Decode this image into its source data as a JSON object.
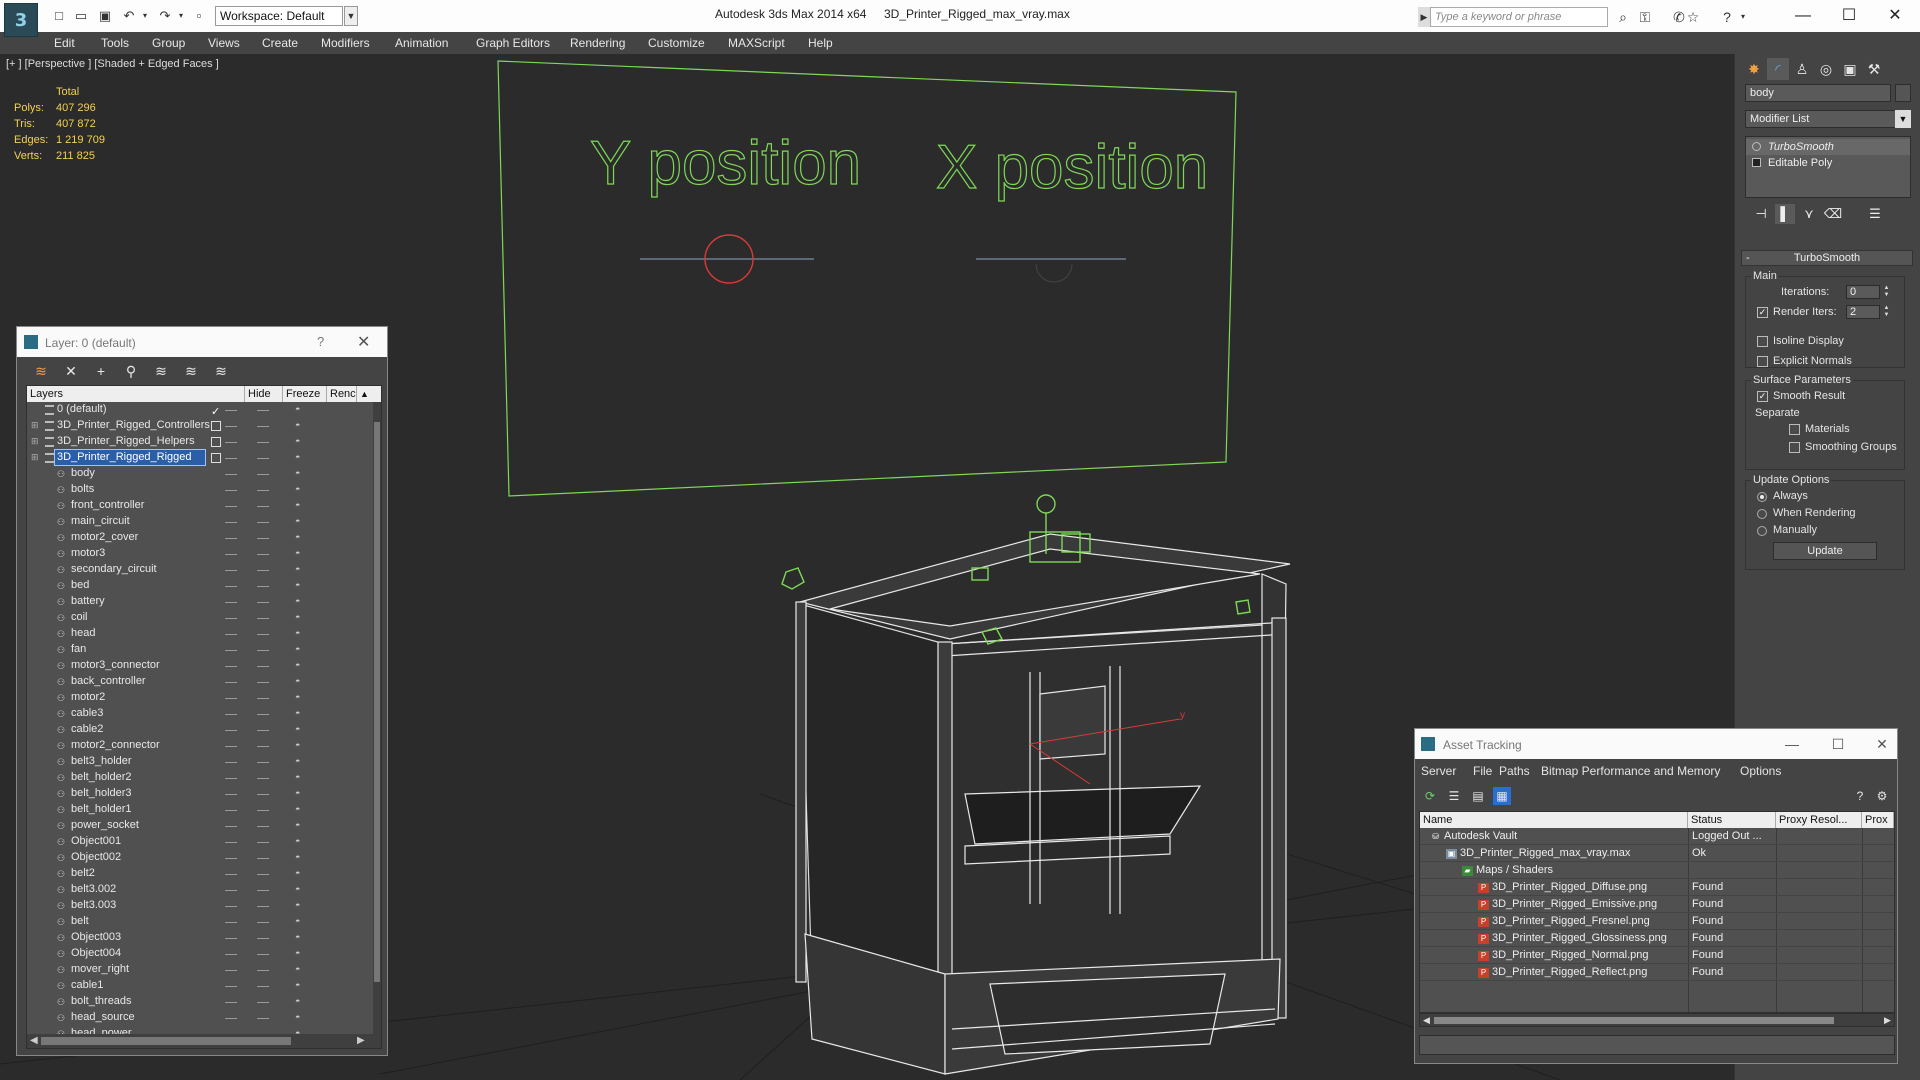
{
  "titlebar": {
    "workspace": "Workspace: Default",
    "app_title": "Autodesk 3ds Max  2014 x64",
    "file_title": "3D_Printer_Rigged_max_vray.max",
    "search_placeholder": "Type a keyword or phrase"
  },
  "menu": [
    "Edit",
    "Tools",
    "Group",
    "Views",
    "Create",
    "Modifiers",
    "Animation",
    "Graph Editors",
    "Rendering",
    "Customize",
    "MAXScript",
    "Help"
  ],
  "viewport": {
    "label": "[+ ] [Perspective ] [Shaded + Edged Faces ]",
    "stats_header": "Total",
    "stats": [
      {
        "label": "Polys:",
        "value": "407 296"
      },
      {
        "label": "Tris:",
        "value": "407 872"
      },
      {
        "label": "Edges:",
        "value": "1 219 709"
      },
      {
        "label": "Verts:",
        "value": "211 825"
      }
    ],
    "ui_text_y": "Y position",
    "ui_text_x": "X position",
    "axis_y": "y"
  },
  "command_panel": {
    "object_name": "body",
    "modifier_list": "Modifier List",
    "stack": [
      "TurboSmooth",
      "Editable Poly"
    ],
    "rollout_title": "TurboSmooth",
    "main_group": "Main",
    "iterations_label": "Iterations:",
    "iterations_value": "0",
    "render_iters_label": "Render Iters:",
    "render_iters_value": "2",
    "render_iters_checked": "✓",
    "isoline_label": "Isoline Display",
    "explicit_label": "Explicit Normals",
    "surface_group": "Surface Parameters",
    "smooth_result_label": "Smooth Result",
    "smooth_result_checked": "✓",
    "separate_label": "Separate",
    "materials_label": "Materials",
    "smoothing_groups_label": "Smoothing Groups",
    "update_options_group": "Update Options",
    "update_always": "Always",
    "update_rendering": "When Rendering",
    "update_manually": "Manually",
    "update_button": "Update"
  },
  "layer_dialog": {
    "title": "Layer: 0 (default)",
    "help": "?",
    "columns": [
      "Layers",
      "Hide",
      "Freeze",
      "Renc"
    ],
    "current_mark": "✓",
    "layers": [
      {
        "name": "0 (default)",
        "level": 0,
        "current": true
      },
      {
        "name": "3D_Printer_Rigged_Controllers",
        "level": 0,
        "expand": true
      },
      {
        "name": "3D_Printer_Rigged_Helpers",
        "level": 0,
        "expand": true
      },
      {
        "name": "3D_Printer_Rigged_Rigged",
        "level": 0,
        "expand": true,
        "selected": true
      }
    ],
    "objects": [
      "body",
      "bolts",
      "front_controller",
      "main_circuit",
      "motor2_cover",
      "motor3",
      "secondary_circuit",
      "bed",
      "battery",
      "coil",
      "head",
      "fan",
      "motor3_connector",
      "back_controller",
      "motor2",
      "cable3",
      "cable2",
      "motor2_connector",
      "belt3_holder",
      "belt_holder2",
      "belt_holder3",
      "belt_holder1",
      "power_socket",
      "Object001",
      "Object002",
      "belt2",
      "belt3.002",
      "belt3.003",
      "belt",
      "Object003",
      "Object004",
      "mover_right",
      "cable1",
      "bolt_threads",
      "head_source",
      "head_power"
    ]
  },
  "asset_dialog": {
    "title": "Asset Tracking",
    "menu": [
      "Server",
      "File",
      "Paths",
      "Bitmap Performance and Memory",
      "Options"
    ],
    "columns": [
      "Name",
      "Status",
      "Proxy Resol...",
      "Prox"
    ],
    "rows": [
      {
        "name": "Autodesk Vault",
        "status": "Logged Out ...",
        "indent": 0,
        "icon": "vault-icon"
      },
      {
        "name": "3D_Printer_Rigged_max_vray.max",
        "status": "Ok",
        "indent": 1,
        "icon": "max-file-icon"
      },
      {
        "name": "Maps / Shaders",
        "status": "",
        "indent": 2,
        "icon": "folder-icon"
      },
      {
        "name": "3D_Printer_Rigged_Diffuse.png",
        "status": "Found",
        "indent": 3,
        "icon": "png-icon"
      },
      {
        "name": "3D_Printer_Rigged_Emissive.png",
        "status": "Found",
        "indent": 3,
        "icon": "png-icon"
      },
      {
        "name": "3D_Printer_Rigged_Fresnel.png",
        "status": "Found",
        "indent": 3,
        "icon": "png-icon"
      },
      {
        "name": "3D_Printer_Rigged_Glossiness.png",
        "status": "Found",
        "indent": 3,
        "icon": "png-icon"
      },
      {
        "name": "3D_Printer_Rigged_Normal.png",
        "status": "Found",
        "indent": 3,
        "icon": "png-icon"
      },
      {
        "name": "3D_Printer_Rigged_Reflect.png",
        "status": "Found",
        "indent": 3,
        "icon": "png-icon"
      }
    ]
  },
  "colors": {
    "viewport_bg": "#2b2b2b",
    "stats_text": "#f3d154",
    "wire_green": "#7ed957",
    "selection_blue": "#2a5fa8",
    "red_circle": "#d83a3a"
  }
}
